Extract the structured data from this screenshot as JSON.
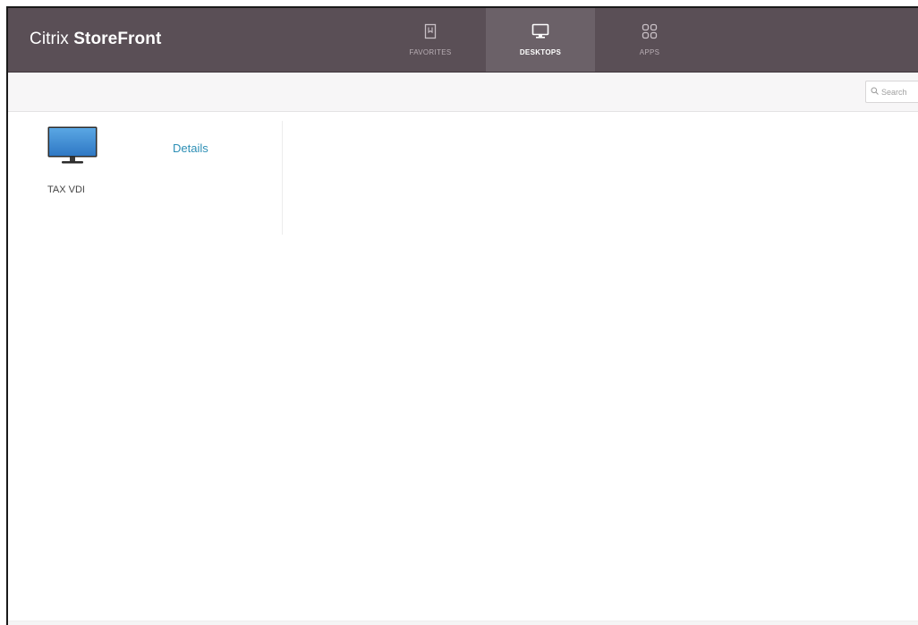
{
  "header": {
    "brand_light": "Citrix",
    "brand_bold": "StoreFront",
    "tabs": [
      {
        "label": "FAVORITES",
        "icon": "bookmark-icon",
        "active": false
      },
      {
        "label": "DESKTOPS",
        "icon": "monitor-icon",
        "active": true
      },
      {
        "label": "APPS",
        "icon": "apps-grid-icon",
        "active": false
      }
    ]
  },
  "toolbar": {
    "search_placeholder": "Search"
  },
  "resources": [
    {
      "name": "TAX VDI",
      "icon": "desktop-monitor-icon"
    }
  ],
  "details": {
    "link_label": "Details"
  },
  "colors": {
    "header_bg": "#5a4f56",
    "active_tab_bg": "#6b6168",
    "link": "#2d8fb5"
  }
}
